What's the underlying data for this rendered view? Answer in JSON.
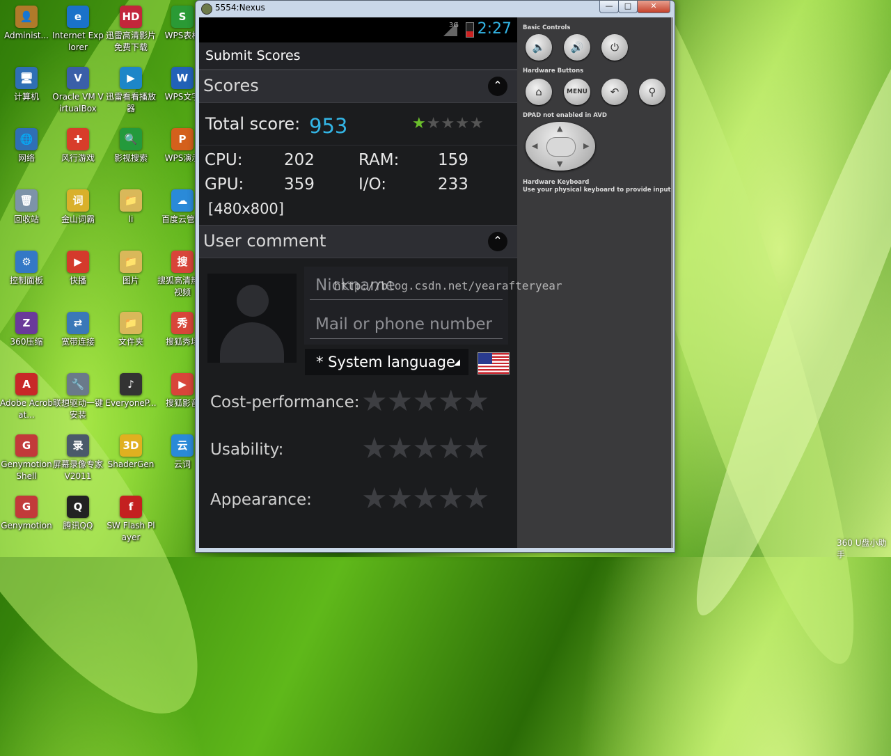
{
  "desktop": {
    "icons": [
      {
        "label": "Administ...",
        "color": "#b07a2a",
        "glyph": "👤"
      },
      {
        "label": "Internet Explorer",
        "color": "#1a72c9",
        "glyph": "e"
      },
      {
        "label": "迅雷高清影片免费下载",
        "color": "#c2263b",
        "glyph": "HD"
      },
      {
        "label": "WPS表格",
        "color": "#2a9a35",
        "glyph": "S"
      },
      {
        "label": "计算机",
        "color": "#2f6fb5",
        "glyph": "🖥"
      },
      {
        "label": "Oracle VM VirtualBox",
        "color": "#3a5fa8",
        "glyph": "V"
      },
      {
        "label": "迅雷看看播放器",
        "color": "#1d86c8",
        "glyph": "▶"
      },
      {
        "label": "WPS文字",
        "color": "#2262b8",
        "glyph": "W"
      },
      {
        "label": "网络",
        "color": "#2f6fb5",
        "glyph": "🌐"
      },
      {
        "label": "风行游戏",
        "color": "#d83d2a",
        "glyph": "✚"
      },
      {
        "label": "影视搜索",
        "color": "#249a3c",
        "glyph": "🔍"
      },
      {
        "label": "WPS演示",
        "color": "#d4601c",
        "glyph": "P"
      },
      {
        "label": "回收站",
        "color": "#7d93a8",
        "glyph": "🗑"
      },
      {
        "label": "金山词霸",
        "color": "#d9b02b",
        "glyph": "词"
      },
      {
        "label": "li",
        "color": "#d9b85a",
        "glyph": "📁"
      },
      {
        "label": "百度云管家",
        "color": "#2a8ad8",
        "glyph": "☁"
      },
      {
        "label": "控制面板",
        "color": "#3478c6",
        "glyph": "⚙"
      },
      {
        "label": "快播",
        "color": "#d43a2c",
        "glyph": "▶"
      },
      {
        "label": "图片",
        "color": "#d9b85a",
        "glyph": "📁"
      },
      {
        "label": "搜狐高清热播视频",
        "color": "#d8453a",
        "glyph": "搜"
      },
      {
        "label": "360压缩",
        "color": "#6a3a9a",
        "glyph": "Z"
      },
      {
        "label": "宽带连接",
        "color": "#3a78b8",
        "glyph": "⇄"
      },
      {
        "label": "文件夹",
        "color": "#d9b85a",
        "glyph": "📁"
      },
      {
        "label": "搜狐秀场",
        "color": "#d8453a",
        "glyph": "秀"
      },
      {
        "label": "Adobe Acrobat...",
        "color": "#c82828",
        "glyph": "A"
      },
      {
        "label": "联想驱动一键安装",
        "color": "#6a7a8a",
        "glyph": "🔧"
      },
      {
        "label": "EveryoneP...",
        "color": "#333333",
        "glyph": "♪"
      },
      {
        "label": "搜狐影音",
        "color": "#d8453a",
        "glyph": "▶"
      },
      {
        "label": "Genymotion Shell",
        "color": "#c23a3a",
        "glyph": "G"
      },
      {
        "label": "屏幕录像专家V2011",
        "color": "#4a5a6a",
        "glyph": "录"
      },
      {
        "label": "ShaderGen",
        "color": "#e0b020",
        "glyph": "3D"
      },
      {
        "label": "云词",
        "color": "#2a8ad8",
        "glyph": "云"
      },
      {
        "label": "Genymotion",
        "color": "#c23a3a",
        "glyph": "G"
      },
      {
        "label": "腾讯QQ",
        "color": "#222222",
        "glyph": "Q"
      },
      {
        "label": "SW Flash Player",
        "color": "#c42020",
        "glyph": "f"
      }
    ]
  },
  "window": {
    "title": "5554:Nexus",
    "min_label": "—",
    "max_label": "□",
    "close_label": "✕"
  },
  "status": {
    "signal": "3G",
    "time": "2:27"
  },
  "app": {
    "action_title": "Submit Scores",
    "scores_header": "Scores",
    "collapse_glyph": "⌃",
    "total_label": "Total score:",
    "total_value": "953",
    "mini_rating": 1,
    "cpu_label": "CPU:",
    "cpu_value": "202",
    "ram_label": "RAM:",
    "ram_value": "159",
    "gpu_label": "GPU:",
    "gpu_value": "359",
    "io_label": "I/O:",
    "io_value": "233",
    "resolution": "[480x800]",
    "comment_header": "User comment",
    "nickname_placeholder": "Nickname",
    "contact_placeholder": "Mail or phone number",
    "language_value": "* System language",
    "ratings": [
      {
        "label": "Cost-performance:",
        "stars": 0
      },
      {
        "label": "Usability:",
        "stars": 0
      },
      {
        "label": "Appearance:",
        "stars": 0
      }
    ]
  },
  "controls": {
    "basic_label": "Basic Controls",
    "hardware_buttons_label": "Hardware Buttons",
    "dpad_label": "DPAD not enabled in AVD",
    "keyboard_label": "Hardware Keyboard",
    "keyboard_hint": "Use your physical keyboard to provide input",
    "menu_label": "MENU"
  },
  "watermark": "http://blog.csdn.net/yearafteryear",
  "tray_text": "360 U盘小助手"
}
